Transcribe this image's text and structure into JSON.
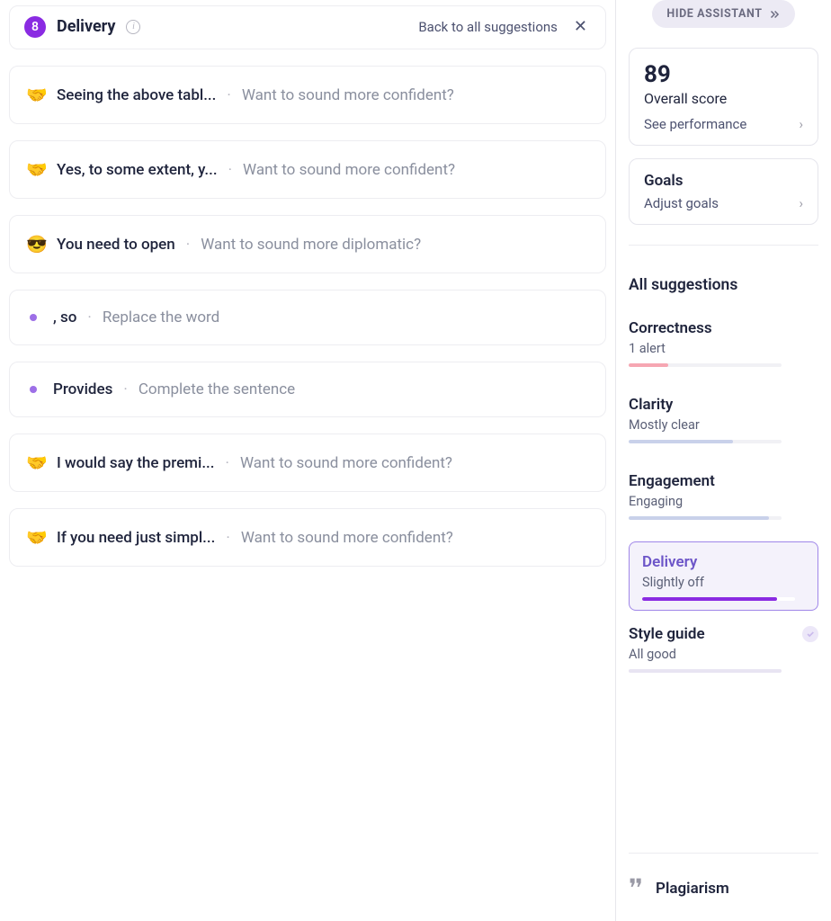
{
  "header": {
    "count": "8",
    "title": "Delivery",
    "back_label": "Back to all suggestions"
  },
  "suggestions": [
    {
      "icon": "🤝",
      "snippet": "Seeing the above tabl...",
      "hint": "Want to sound more confident?"
    },
    {
      "icon": "🤝",
      "snippet": "Yes, to some extent, y...",
      "hint": "Want to sound more confident?"
    },
    {
      "icon": "😎",
      "snippet": "You need to open",
      "hint": "Want to sound more diplomatic?"
    },
    {
      "icon": "dot",
      "snippet": ", so",
      "hint": "Replace the word"
    },
    {
      "icon": "dot",
      "snippet": "Provides",
      "hint": "Complete the sentence"
    },
    {
      "icon": "🤝",
      "snippet": "I would say the premi...",
      "hint": "Want to sound more confident?"
    },
    {
      "icon": "🤝",
      "snippet": "If you need just simpl...",
      "hint": "Want to sound more confident?"
    }
  ],
  "sidebar": {
    "hide_label": "HIDE ASSISTANT",
    "score": {
      "value": "89",
      "label": "Overall score",
      "link": "See performance"
    },
    "goals": {
      "title": "Goals",
      "link": "Adjust goals"
    },
    "all_label": "All suggestions",
    "metrics": {
      "correctness": {
        "title": "Correctness",
        "sub": "1 alert",
        "color": "#f6a6b2",
        "pct": 26
      },
      "clarity": {
        "title": "Clarity",
        "sub": "Mostly clear",
        "color": "#c9d1ea",
        "pct": 68
      },
      "engagement": {
        "title": "Engagement",
        "sub": "Engaging",
        "color": "#c9d1ea",
        "pct": 92
      },
      "delivery": {
        "title": "Delivery",
        "sub": "Slightly off",
        "color": "#8a2be2",
        "pct": 88
      },
      "style": {
        "title": "Style guide",
        "sub": "All good",
        "color": "#e8e4f2",
        "pct": 100
      }
    },
    "plagiarism": "Plagiarism"
  }
}
